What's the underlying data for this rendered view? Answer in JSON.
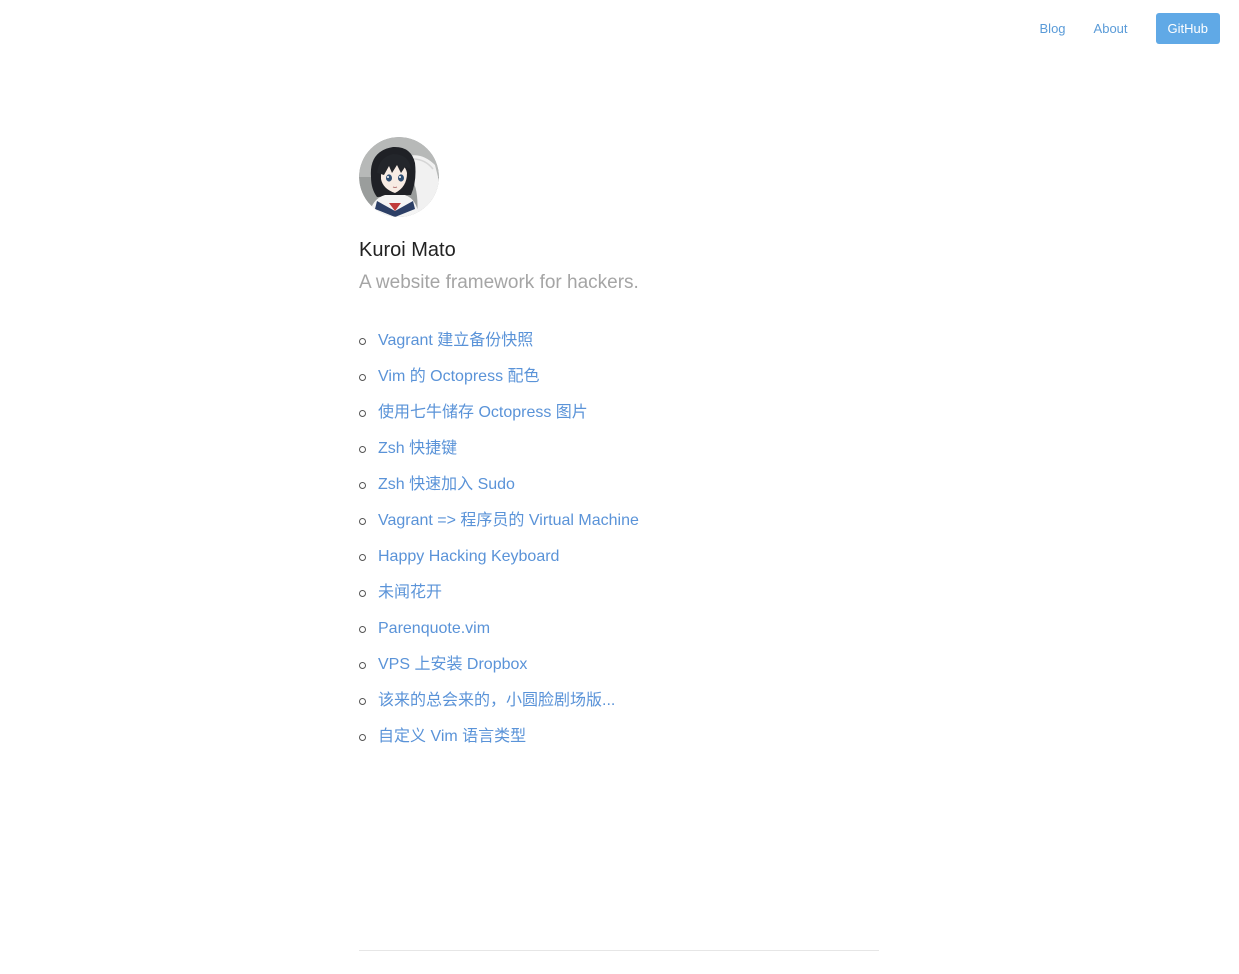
{
  "nav": {
    "blog_label": "Blog",
    "about_label": "About",
    "github_label": "GitHub"
  },
  "profile": {
    "avatar_icon": "anime-girl-avatar-icon",
    "title": "Kuroi Mato",
    "description": "A website framework for hackers."
  },
  "posts": [
    {
      "label": "Vagrant 建立备份快照"
    },
    {
      "label": "Vim 的 Octopress 配色"
    },
    {
      "label": "使用七牛储存 Octopress 图片"
    },
    {
      "label": "Zsh 快捷键"
    },
    {
      "label": "Zsh 快速加入 Sudo"
    },
    {
      "label": "Vagrant => 程序员的 Virtual Machine"
    },
    {
      "label": "Happy Hacking Keyboard"
    },
    {
      "label": "未闻花开"
    },
    {
      "label": "Parenquote.vim"
    },
    {
      "label": "VPS 上安装 Dropbox"
    },
    {
      "label": "该来的总会来的，小圆脸剧场版..."
    },
    {
      "label": "自定义 Vim 语言类型"
    }
  ],
  "colors": {
    "link": "#5a93d8",
    "button_bg": "#60a9e6",
    "muted_text": "#a5a5a5",
    "title_text": "#222222"
  }
}
